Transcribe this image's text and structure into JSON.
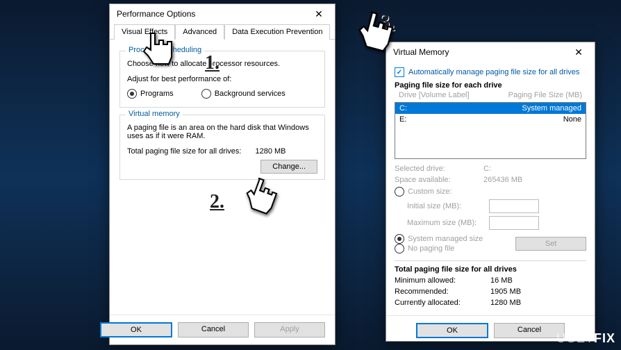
{
  "perf": {
    "title": "Performance Options",
    "tabs": {
      "visual": "Visual Effects",
      "advanced": "Advanced",
      "dep": "Data Execution Prevention"
    },
    "proc": {
      "title": "Processor scheduling",
      "desc": "Choose how to allocate processor resources.",
      "adjust": "Adjust for best performance of:",
      "programs": "Programs",
      "background": "Background services"
    },
    "vm": {
      "title": "Virtual memory",
      "desc": "A paging file is an area on the hard disk that Windows uses as if it were RAM.",
      "total_label": "Total paging file size for all drives:",
      "total_value": "1280 MB",
      "change": "Change..."
    },
    "ok": "OK",
    "cancel": "Cancel",
    "apply": "Apply"
  },
  "vmem": {
    "title": "Virtual Memory",
    "auto": "Automatically manage paging file size for all drives",
    "paging_title": "Paging file size for each drive",
    "hdr_drive": "Drive  [Volume Label]",
    "hdr_size": "Paging File Size (MB)",
    "drives": [
      {
        "d": "C:",
        "s": "System managed"
      },
      {
        "d": "E:",
        "s": "None"
      }
    ],
    "sel_drive_l": "Selected drive:",
    "sel_drive_v": "C:",
    "space_l": "Space available:",
    "space_v": "265436 MB",
    "custom": "Custom size:",
    "initial": "Initial size (MB):",
    "max": "Maximum size (MB):",
    "sysmanaged": "System managed size",
    "nopaging": "No paging file",
    "set": "Set",
    "totals_title": "Total paging file size for all drives",
    "min_l": "Minimum allowed:",
    "min_v": "16 MB",
    "rec_l": "Recommended:",
    "rec_v": "1905 MB",
    "cur_l": "Currently allocated:",
    "cur_v": "1280 MB",
    "ok": "OK",
    "cancel": "Cancel"
  },
  "steps": {
    "s1": "1.",
    "s2": "2.",
    "s3": "3."
  },
  "watermark": {
    "a": "UGET",
    "b": "FIX"
  }
}
